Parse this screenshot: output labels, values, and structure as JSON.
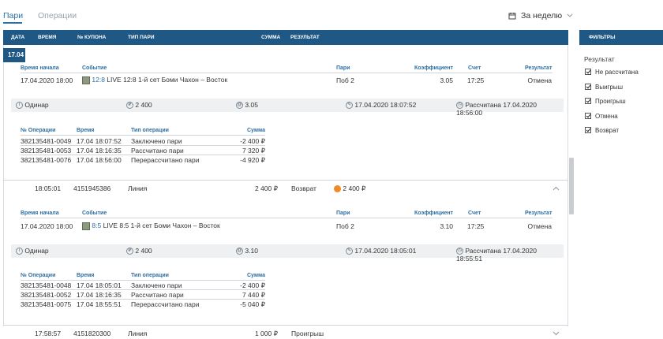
{
  "tabs": [
    {
      "label": "Пари",
      "active": true
    },
    {
      "label": "Операции",
      "active": false
    }
  ],
  "period": {
    "label": "За неделю"
  },
  "table_header": [
    "ДАТА",
    "ВРЕМЯ",
    "№ КУПОНА",
    "ТИП ПАРИ",
    "СУММА",
    "РЕЗУЛЬТАТ"
  ],
  "date_group": "17.04",
  "bet_headers": [
    "Время начала",
    "Событие",
    "Пари",
    "Коэффициент",
    "Счет",
    "Результат"
  ],
  "op_headers": [
    "№ Операции",
    "Время",
    "Тип операции",
    "Сумма"
  ],
  "bet1": {
    "start": "17.04.2020 18:00",
    "score_link": "12:8",
    "event": "LIVE 12:8 1-й сет Боми Чахон – Восток",
    "pari": "Поб 2",
    "coef": "3.05",
    "score": "17:25",
    "result": "Отмена",
    "info": {
      "type": "Одинар",
      "amount": "2 400",
      "coef": "3.05",
      "placed": "17.04.2020 18:07:52",
      "settled": "Рассчитана 17.04.2020 18:56:00"
    },
    "ops": [
      {
        "id": "382135481-0049",
        "time": "17.04 18:07:52",
        "type": "Заключено пари",
        "sum": "-2 400 ₽"
      },
      {
        "id": "382135481-0053",
        "time": "17.04 18:16:35",
        "type": "Рассчитано пари",
        "sum": "7 320 ₽"
      },
      {
        "id": "382135481-0076",
        "time": "17.04 18:56:00",
        "type": "Перерассчитано пари",
        "sum": "-4 920 ₽"
      }
    ]
  },
  "row2": {
    "time": "18:05:01",
    "coupon": "4151945386",
    "type": "Линия",
    "sum": "2 400 ₽",
    "result": "Возврат",
    "refund": "2 400 ₽"
  },
  "bet2": {
    "start": "17.04.2020 18:00",
    "score_link": "8:5",
    "event": "LIVE 8:5 1-й сет Боми Чахон – Восток",
    "pari": "Поб 2",
    "coef": "3.10",
    "score": "17:25",
    "result": "Отмена",
    "info": {
      "type": "Одинар",
      "amount": "2 400",
      "coef": "3.10",
      "placed": "17.04.2020 18:05:01",
      "settled": "Рассчитана 17.04.2020 18:55:51"
    },
    "ops": [
      {
        "id": "382135481-0048",
        "time": "17.04 18:05:01",
        "type": "Заключено пари",
        "sum": "-2 400 ₽"
      },
      {
        "id": "382135481-0052",
        "time": "17.04 18:16:35",
        "type": "Рассчитано пари",
        "sum": "7 440 ₽"
      },
      {
        "id": "382135481-0075",
        "time": "17.04 18:55:51",
        "type": "Перерассчитано пари",
        "sum": "-5 040 ₽"
      }
    ]
  },
  "row3": {
    "time": "17:58:57",
    "coupon": "4151820300",
    "type": "Линия",
    "sum": "1 000 ₽",
    "result": "Проигрыш"
  },
  "filters": {
    "title": "ФИЛЬТРЫ",
    "group": "Результат",
    "items": [
      "Не рассчитана",
      "Выигрыш",
      "Проигрыш",
      "Отмена",
      "Возврат"
    ]
  }
}
